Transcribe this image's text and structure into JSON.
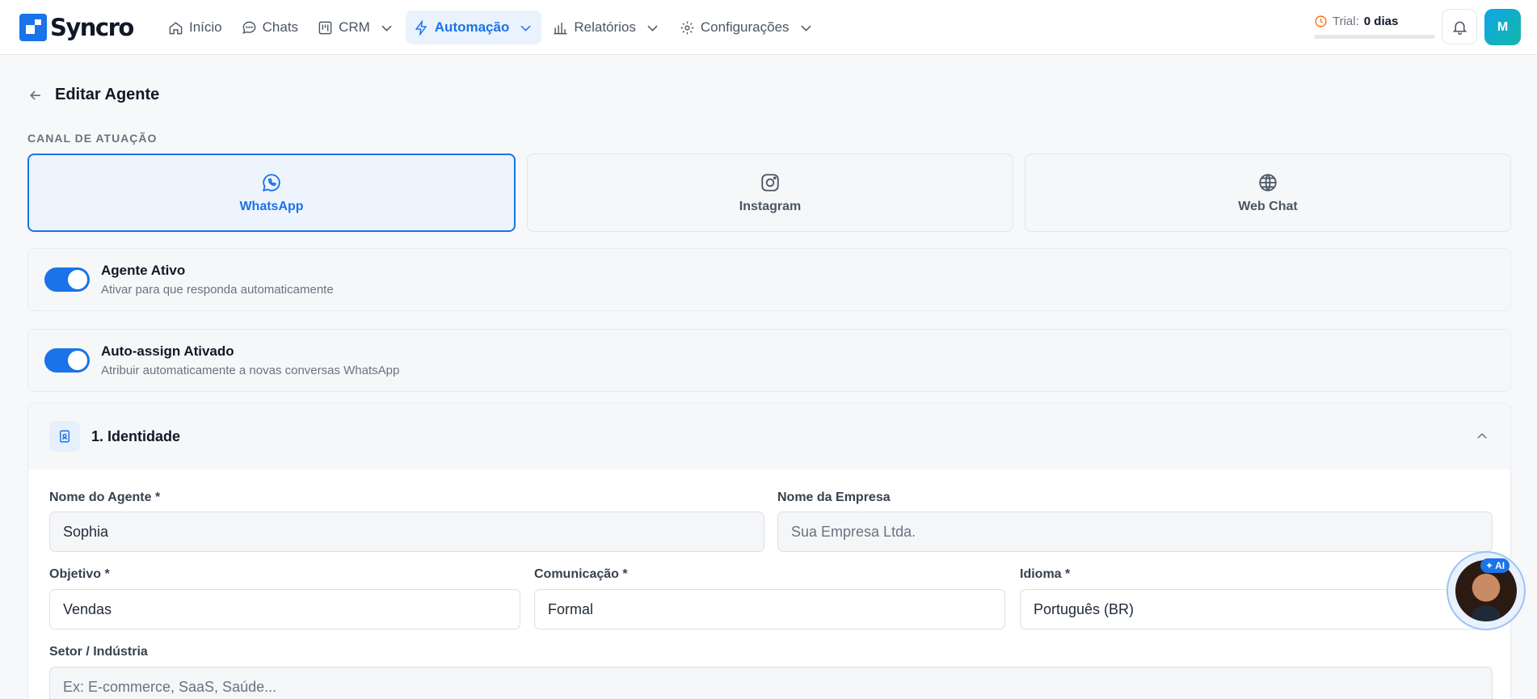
{
  "app": {
    "brand": "Syncro"
  },
  "nav": {
    "items": [
      {
        "label": "Início",
        "icon": "home-icon"
      },
      {
        "label": "Chats",
        "icon": "chat-icon"
      },
      {
        "label": "CRM",
        "icon": "kanban-icon"
      },
      {
        "label": "Automação",
        "icon": "bolt-icon",
        "active": true
      },
      {
        "label": "Relatórios",
        "icon": "bar-chart-icon"
      },
      {
        "label": "Configurações",
        "icon": "gear-icon"
      }
    ]
  },
  "trial": {
    "label": "Trial:",
    "value": "0 dias"
  },
  "user": {
    "initial": "M"
  },
  "page": {
    "title": "Editar Agente",
    "channel_label": "CANAL DE ATUAÇÃO"
  },
  "channels": [
    {
      "label": "WhatsApp",
      "icon": "whatsapp-icon",
      "selected": true
    },
    {
      "label": "Instagram",
      "icon": "instagram-icon",
      "selected": false
    },
    {
      "label": "Web Chat",
      "icon": "globe-icon",
      "selected": false
    }
  ],
  "toggles": {
    "active": {
      "title": "Agente Ativo",
      "desc": "Ativar para que responda automaticamente",
      "on": true
    },
    "autoassign": {
      "title": "Auto-assign Ativado",
      "desc": "Atribuir automaticamente a novas conversas WhatsApp",
      "on": true
    }
  },
  "identity": {
    "title": "1. Identidade",
    "agent_name": {
      "label": "Nome do Agente *",
      "value": "Sophia"
    },
    "company": {
      "label": "Nome da Empresa",
      "placeholder": "Sua Empresa Ltda."
    },
    "objective": {
      "label": "Objetivo *",
      "value": "Vendas"
    },
    "communication": {
      "label": "Comunicação *",
      "value": "Formal"
    },
    "language": {
      "label": "Idioma *",
      "value": "Português (BR)"
    },
    "sector": {
      "label": "Setor / Indústria",
      "placeholder": "Ex: E-commerce, SaaS, Saúde..."
    }
  },
  "ai_fab": {
    "badge": "AI"
  },
  "colors": {
    "accent": "#1a73e8",
    "trial_icon": "#f97316"
  }
}
